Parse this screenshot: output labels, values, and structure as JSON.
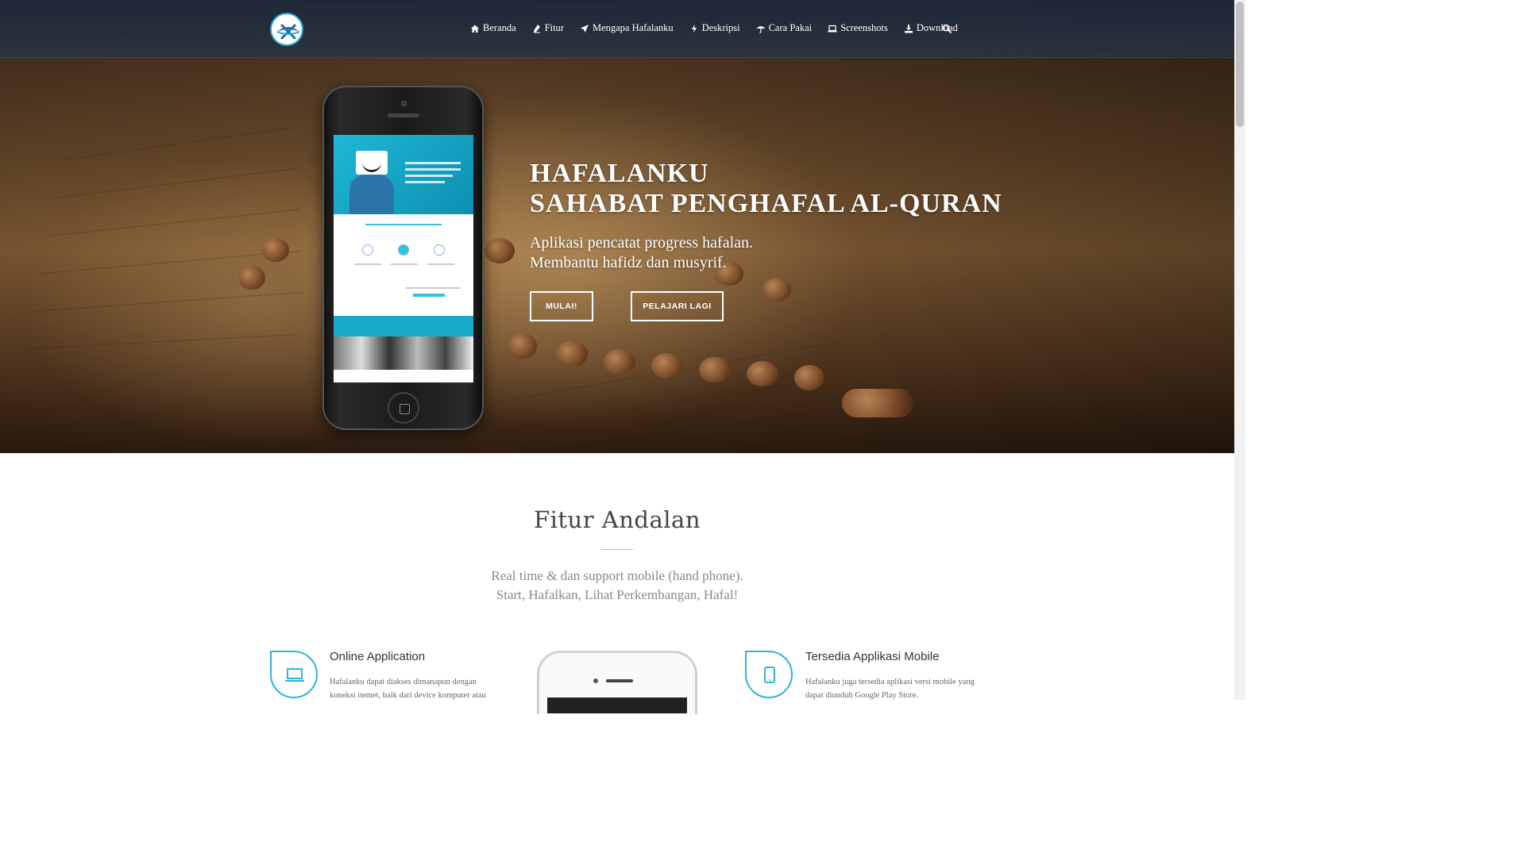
{
  "nav": {
    "items": [
      {
        "label": "Beranda",
        "icon": "home-icon"
      },
      {
        "label": "Fitur",
        "icon": "pen-icon"
      },
      {
        "label": "Mengapa Hafalanku",
        "icon": "paper-plane-icon"
      },
      {
        "label": "Deskripsi",
        "icon": "bolt-icon"
      },
      {
        "label": "Cara Pakai",
        "icon": "umbrella-icon"
      },
      {
        "label": "Screenshots",
        "icon": "laptop-icon"
      },
      {
        "label": "Download",
        "icon": "download-icon"
      }
    ],
    "search_icon": "search-icon"
  },
  "hero": {
    "title_line1": "HAFALANKU",
    "title_line2": "SAHABAT PENGHAFAL AL-QURAN",
    "subtitle_line1": "Aplikasi pencatat progress hafalan.",
    "subtitle_line2": "Membantu hafidz dan musyrif.",
    "btn_start": "MULAI!",
    "btn_learn": "PELAJARI LAGI"
  },
  "features": {
    "title": "Fitur Andalan",
    "sub_line1": "Real time & dan support mobile (hand phone).",
    "sub_line2": "Start, Hafalkan, Lihat Perkembangan, Hafal!",
    "items": [
      {
        "title": "Online Application",
        "desc": "Hafalanku dapat diakses dimanapun dengan koneksi itemet, baik dari device komputer atau",
        "icon": "laptop-icon"
      },
      {
        "title": "Tersedia Applikasi Mobile",
        "desc": "Hafalanku juga tersedia aplikasi versi mobile yang dapat diunduh Google Play Store.",
        "icon": "tablet-icon"
      }
    ]
  },
  "colors": {
    "accent": "#2cb5d8",
    "nav_bg": "#1c283a",
    "text_muted": "#8a8a8a"
  }
}
